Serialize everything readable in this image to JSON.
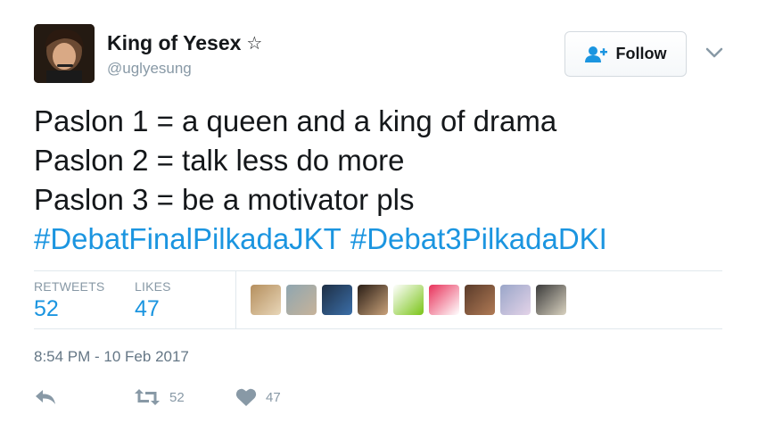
{
  "tweet": {
    "display_name": "King of Yesex",
    "name_symbol": "☆",
    "handle": "@uglyesung",
    "follow_label": "Follow",
    "text_lines": [
      "Paslon 1 = a queen and a king of drama",
      "Paslon 2 = talk less do more",
      "Paslon 3 = be a motivator pls"
    ],
    "hashtags": [
      "#DebatFinalPilkadaJKT",
      "#Debat3PilkadaDKI"
    ],
    "stats": {
      "retweets_label": "RETWEETS",
      "retweets_count": "52",
      "likes_label": "LIKES",
      "likes_count": "47"
    },
    "liker_avatars": [
      {
        "name": "liker-1",
        "colors": [
          "#b58f5e",
          "#e8d6b8"
        ]
      },
      {
        "name": "liker-2",
        "colors": [
          "#8fa6b0",
          "#c7b39a"
        ]
      },
      {
        "name": "liker-3",
        "colors": [
          "#1e2f45",
          "#3b6ea8"
        ]
      },
      {
        "name": "liker-4",
        "colors": [
          "#2a1e16",
          "#c9a27a"
        ]
      },
      {
        "name": "liker-5",
        "colors": [
          "#ffffff",
          "#7ac417"
        ]
      },
      {
        "name": "liker-6",
        "colors": [
          "#e8315a",
          "#ffffff"
        ]
      },
      {
        "name": "liker-7",
        "colors": [
          "#5a3b2a",
          "#b07a55"
        ]
      },
      {
        "name": "liker-8",
        "colors": [
          "#9aa6c9",
          "#e3d3e8"
        ]
      },
      {
        "name": "liker-9",
        "colors": [
          "#3b3b3b",
          "#d9d2c0"
        ]
      }
    ],
    "timestamp": "8:54 PM - 10 Feb 2017",
    "actions": {
      "reply_icon": "reply-icon",
      "retweet_icon": "retweet-icon",
      "retweet_count": "52",
      "like_icon": "heart-icon",
      "like_count": "47"
    },
    "colors": {
      "link": "#1b95e0",
      "muted": "#8899a6",
      "text": "#14171a",
      "border": "#e1e8ed",
      "follow_icon": "#1b95e0"
    }
  }
}
